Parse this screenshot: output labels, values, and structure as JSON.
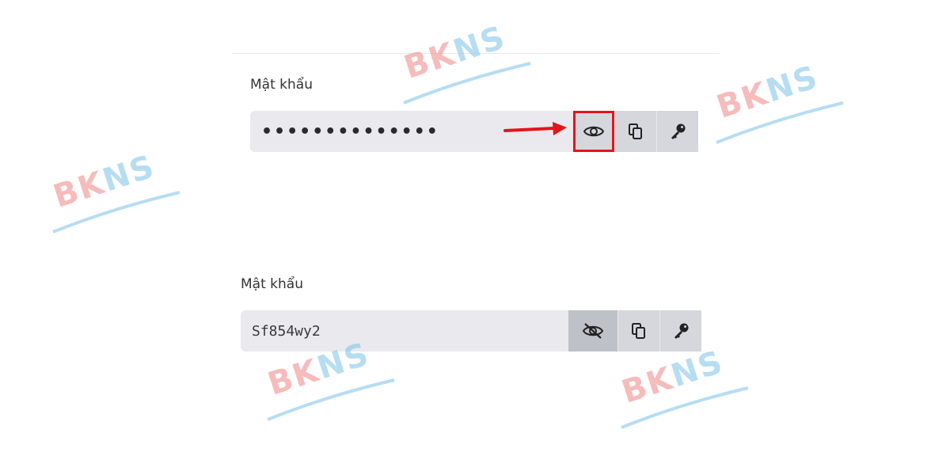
{
  "section_one": {
    "label": "Mật khẩu",
    "password_value": "••••••••••••••",
    "buttons": {
      "show": "eye-icon",
      "copy": "copy-icon",
      "generate": "key-icon"
    },
    "annotation_arrow_color": "#e4141c",
    "highlight_color": "#e4141c"
  },
  "section_two": {
    "label": "Mật khẩu",
    "password_value": "Sf854wy2",
    "buttons": {
      "hide": "eye-slash-icon",
      "copy": "copy-icon",
      "generate": "key-icon"
    }
  },
  "watermark": {
    "brand_red": "BK",
    "brand_blue": "NS",
    "red_color": "#f08585",
    "blue_color": "#7cc2e8"
  }
}
